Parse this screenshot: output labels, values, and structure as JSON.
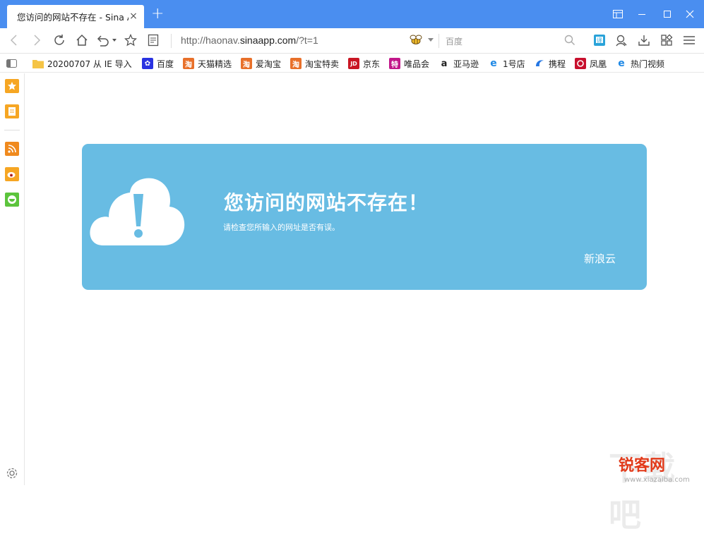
{
  "tab": {
    "title": "您访问的网站不存在 - Sina App Engine",
    "close": "×"
  },
  "newtab": "+",
  "toolbar": {
    "url_prefix": "http://haonav.",
    "url_host": "sinaapp.com",
    "url_suffix": "/?t=1",
    "search_placeholder": "百度"
  },
  "bookmarks": [
    {
      "label": "20200707 从 IE 导入",
      "icon": "folder-icon",
      "color": "#f5c445"
    },
    {
      "label": "百度",
      "icon": "baidu-icon",
      "color": "#2932e1"
    },
    {
      "label": "天猫精选",
      "icon": "taobao-icon",
      "color": "#e8702a"
    },
    {
      "label": "爱淘宝",
      "icon": "taobao-icon",
      "color": "#e8702a"
    },
    {
      "label": "淘宝特卖",
      "icon": "taobao-icon",
      "color": "#e8702a"
    },
    {
      "label": "京东",
      "icon": "jd-icon",
      "color": "#c91623"
    },
    {
      "label": "唯品会",
      "icon": "vip-icon",
      "color": "#c2178a"
    },
    {
      "label": "亚马逊",
      "icon": "amazon-icon",
      "color": "#222222"
    },
    {
      "label": "1号店",
      "icon": "ie-icon",
      "color": "#1e88e5"
    },
    {
      "label": "携程",
      "icon": "ctrip-icon",
      "color": "#2577e3"
    },
    {
      "label": "凤凰",
      "icon": "ifeng-icon",
      "color": "#c8102e"
    },
    {
      "label": "热门视频",
      "icon": "ie-icon",
      "color": "#1e88e5"
    }
  ],
  "error": {
    "title": "您访问的网站不存在！",
    "subtitle": "请检查您所输入的网址是否有误。",
    "brand": "新浪云"
  },
  "watermark": {
    "logo": "锐客网",
    "big": "下载吧",
    "url": "www.xiazaiba.com"
  },
  "colors": {
    "titlebar": "#4a8ef0",
    "panel": "#68bce3",
    "sidebar_orange": "#f6a623",
    "sidebar_green": "#5cc43c"
  }
}
